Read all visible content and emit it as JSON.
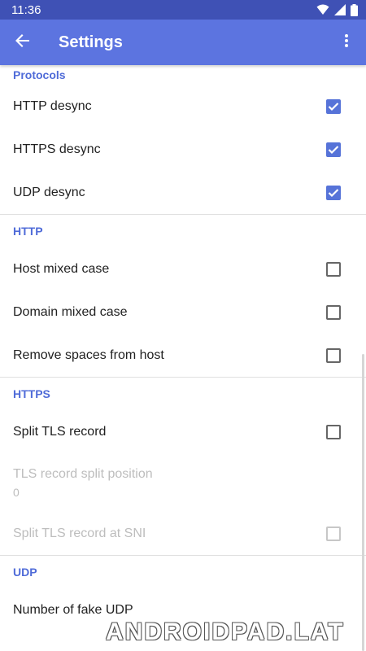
{
  "status_bar": {
    "time": "11:36"
  },
  "toolbar": {
    "title": "Settings"
  },
  "sections": {
    "protocols": {
      "title": "Protocols",
      "items": [
        {
          "label": "HTTP desync",
          "checked": true
        },
        {
          "label": "HTTPS desync",
          "checked": true
        },
        {
          "label": "UDP desync",
          "checked": true
        }
      ]
    },
    "http": {
      "title": "HTTP",
      "items": [
        {
          "label": "Host mixed case",
          "checked": false
        },
        {
          "label": "Domain mixed case",
          "checked": false
        },
        {
          "label": "Remove spaces from host",
          "checked": false
        }
      ]
    },
    "https": {
      "title": "HTTPS",
      "split_tls": {
        "label": "Split TLS record",
        "checked": false
      },
      "split_position": {
        "label": "TLS record split position",
        "value": "0"
      },
      "split_at_sni": {
        "label": "Split TLS record at SNI",
        "checked": false
      }
    },
    "udp": {
      "title": "UDP",
      "fake_count": {
        "label": "Number of fake UDP"
      }
    }
  },
  "watermark": "ANDROIDPAD.LAT",
  "colors": {
    "status_bar": "#3f51b5",
    "toolbar": "#5c74e0",
    "accent": "#5673d8",
    "category": "#4f6bd8"
  }
}
